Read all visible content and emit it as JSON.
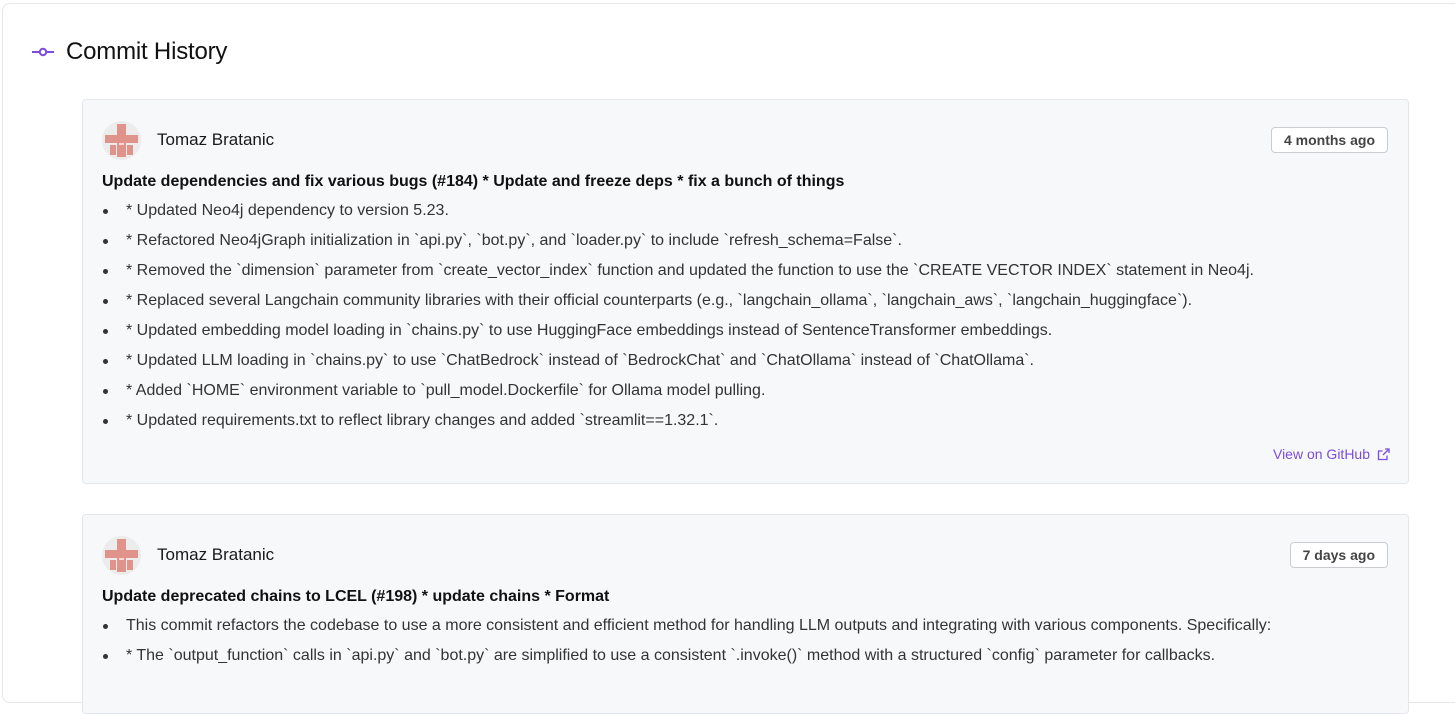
{
  "page": {
    "title": "Commit History"
  },
  "colors": {
    "accent": "#7c4ddb",
    "avatar_pattern": "#e0938a"
  },
  "commits": [
    {
      "author": "Tomaz Bratanic",
      "time": "4 months ago",
      "title": "Update dependencies and fix various bugs (#184) * Update and freeze deps * fix a bunch of things",
      "bullets": [
        "* Updated Neo4j dependency to version 5.23.",
        "* Refactored Neo4jGraph initialization in `api.py`, `bot.py`, and `loader.py` to include `refresh_schema=False`.",
        "* Removed the `dimension` parameter from `create_vector_index` function and updated the function to use the `CREATE VECTOR INDEX` statement in Neo4j.",
        "* Replaced several Langchain community libraries with their official counterparts (e.g., `langchain_ollama`, `langchain_aws`, `langchain_huggingface`).",
        "* Updated embedding model loading in `chains.py` to use HuggingFace embeddings instead of SentenceTransformer embeddings.",
        "* Updated LLM loading in `chains.py` to use `ChatBedrock` instead of `BedrockChat` and `ChatOllama` instead of `ChatOllama`.",
        "* Added `HOME` environment variable to `pull_model.Dockerfile` for Ollama model pulling.",
        "* Updated requirements.txt to reflect library changes and added `streamlit==1.32.1`."
      ],
      "link": "View on GitHub"
    },
    {
      "author": "Tomaz Bratanic",
      "time": "7 days ago",
      "title": "Update deprecated chains to LCEL (#198) * update chains * Format",
      "bullets": [
        "This commit refactors the codebase to use a more consistent and efficient method for handling LLM outputs and integrating with various components. Specifically:",
        "* The `output_function` calls in `api.py` and `bot.py` are simplified to use a consistent `.invoke()` method with a structured `config` parameter for callbacks."
      ]
    }
  ]
}
